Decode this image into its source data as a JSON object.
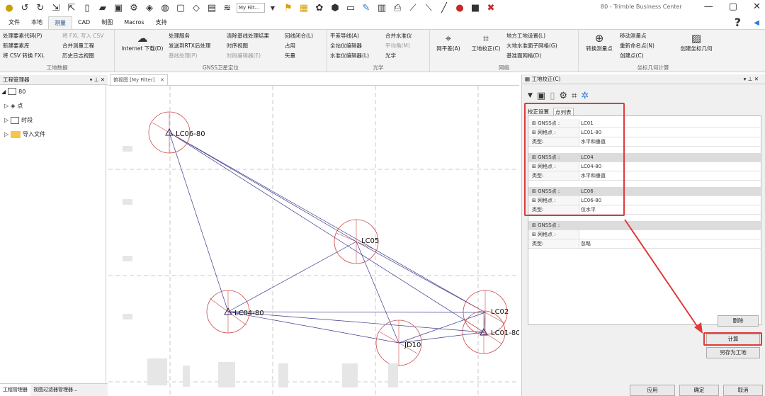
{
  "window": {
    "title": "80 - Trimble Business Center"
  },
  "qat": {
    "filter_value": "My Filt..."
  },
  "menu_tabs": [
    "文件",
    "本地",
    "测量",
    "CAD",
    "制图",
    "Macros",
    "支持"
  ],
  "active_tab": "测量",
  "ribbon": {
    "survey_data": {
      "label": "工地数据",
      "items": [
        "处理要素代码(P)",
        "将 FXL 写入 CSV",
        "新建要素库",
        "合并测量工程",
        "将 CSV 转换 FXL",
        "历史日志视图"
      ]
    },
    "gnss": {
      "label": "GNSS卫星定位",
      "internet_download": "Internet 下载(D)",
      "items": [
        "处理服务",
        "清除基线处理结果",
        "回线闭合(L)",
        "发送到RTX后处理",
        "时序视图",
        "占用",
        "基线处理(P)",
        "时段编辑器(E)",
        "矢量"
      ]
    },
    "optical": {
      "label": "光学",
      "items": [
        "平差导线(A)",
        "合并水准仪",
        "全站仪编辑器",
        "平均角(M)",
        "水准仪编辑器(L)",
        "光学"
      ]
    },
    "network": {
      "label": "网络",
      "adjust": "网平差(A)",
      "calibrate": "工地校正(C)",
      "items": [
        "地方工地设置(L)",
        "大地水准面子网格(G)",
        "基准面网格(D)"
      ]
    },
    "cogo": {
      "label": "坐标几何计算",
      "convert": "转换测量点",
      "items": [
        "移动测量点",
        "重新命名点(N)",
        "创建点(C)"
      ],
      "create_geom": "创建坐标几何"
    }
  },
  "left_panel": {
    "title": "工程管理器",
    "tree": [
      {
        "label": "80"
      },
      {
        "label": "点"
      },
      {
        "label": "时段"
      },
      {
        "label": "导入文件"
      }
    ],
    "bottom_tabs": [
      "工程管理器",
      "视图过滤器管理器..."
    ]
  },
  "plan_view": {
    "tab_label": "俯视图 [My Filter]",
    "points": [
      "LC06-80",
      "LC05",
      "LC04-80",
      "JD10",
      "LC02",
      "LC01-80"
    ]
  },
  "calibration_panel": {
    "title": "工地校正(C)",
    "subtabs": [
      "校正设置",
      "点列表"
    ],
    "groups": [
      {
        "gnss_label": "GNSS点 :",
        "gnss": "LC01",
        "grid_label": "网格点 :",
        "grid": "LC01-80",
        "type_label": "类型:",
        "type": "水平和垂直"
      },
      {
        "gnss_label": "GNSS点 :",
        "gnss": "LC04",
        "grid_label": "网格点 :",
        "grid": "LC04-80",
        "type_label": "类型:",
        "type": "水平和垂直"
      },
      {
        "gnss_label": "GNSS点 :",
        "gnss": "LC06",
        "grid_label": "网格点 :",
        "grid": "LC06-80",
        "type_label": "类型:",
        "type": "仅水平"
      },
      {
        "gnss_label": "GNSS点 :",
        "gnss": "",
        "grid_label": "网格点 :",
        "grid": "",
        "type_label": "类型:",
        "type": "忽略"
      }
    ],
    "buttons": {
      "delete": "删除",
      "compute": "计算",
      "save_as_site": "另存为工地",
      "apply": "应用",
      "ok": "确定",
      "cancel": "取消"
    }
  },
  "colors": {
    "highlight": "#e03a3a",
    "accent": "#1a4d8f"
  }
}
